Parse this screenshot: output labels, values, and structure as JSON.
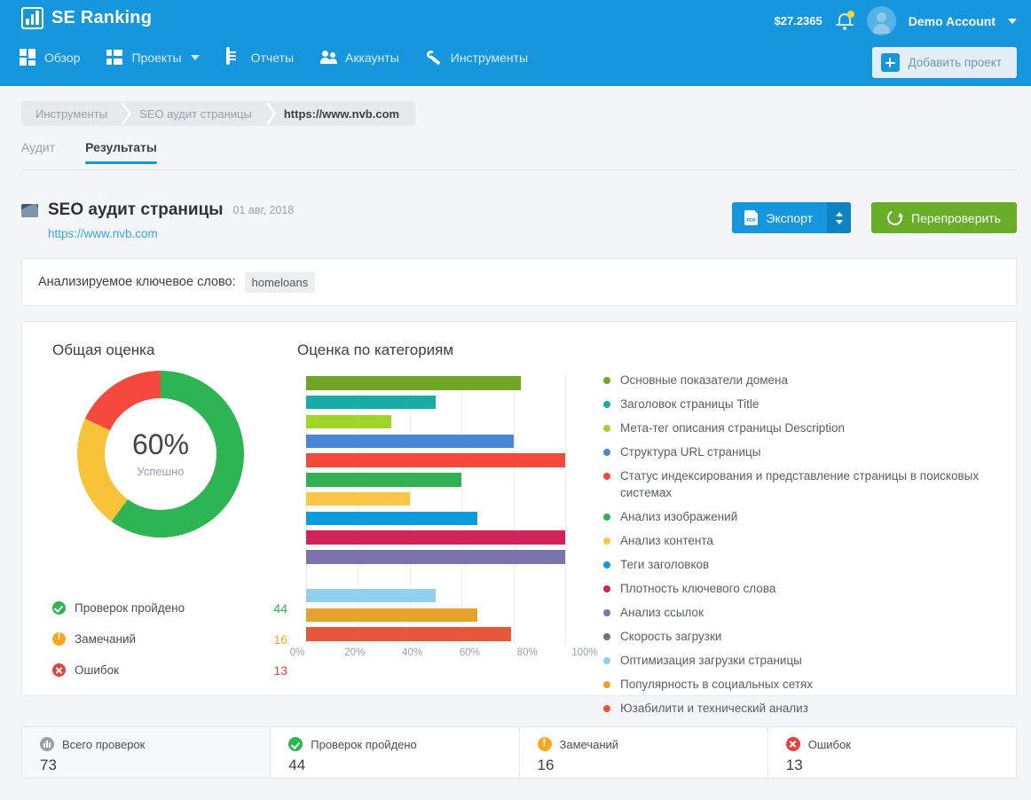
{
  "header": {
    "brand": "SE Ranking",
    "brand_logo_icon": "bar-chart-logo-icon",
    "balance": "$27.2365",
    "bell_icon": "notification-bell-icon",
    "avatar_icon": "user-avatar-icon",
    "account_name": "Demo Account",
    "account_caret_icon": "chevron-down-icon",
    "add_project_label": "Добавить проект",
    "add_project_icon": "plus-icon",
    "nav": [
      {
        "label": "Обзор",
        "icon": "dashboard-grid-icon",
        "caret": false
      },
      {
        "label": "Проекты",
        "icon": "projects-list-icon",
        "caret": true
      },
      {
        "label": "Отчеты",
        "icon": "reports-document-icon",
        "caret": false
      },
      {
        "label": "Аккаунты",
        "icon": "accounts-people-icon",
        "caret": false
      },
      {
        "label": "Инструменты",
        "icon": "tools-wrench-icon",
        "caret": false
      }
    ]
  },
  "breadcrumb": [
    "Инструменты",
    "SEO аудит страницы",
    "https://www.nvb.com"
  ],
  "tabs": [
    {
      "label": "Аудит",
      "active": false
    },
    {
      "label": "Результаты",
      "active": true
    }
  ],
  "page": {
    "icon": "page-audit-icon",
    "title": "SEO аудит страницы",
    "date": "01 авг, 2018",
    "url": "https://www.nvb.com",
    "export_label": "Экспорт",
    "export_icon": "pdf-icon",
    "export_split_icon": "updown-arrows-icon",
    "recheck_label": "Перепроверить",
    "recheck_icon": "reload-icon"
  },
  "keyword_panel": {
    "label": "Анализируемое ключевое слово:",
    "value": "homeloans"
  },
  "overall": {
    "title": "Общая оценка",
    "percent": "60%",
    "subtitle": "Успешно",
    "stats": [
      {
        "label": "Проверок пройдено",
        "value": "44",
        "kind": "ok"
      },
      {
        "label": "Замечаний",
        "value": "16",
        "kind": "warn"
      },
      {
        "label": "Ошибок",
        "value": "13",
        "kind": "err"
      }
    ]
  },
  "categories_title": "Оценка по категориям",
  "summary": [
    {
      "label": "Всего проверок",
      "value": "73",
      "kind": "total"
    },
    {
      "label": "Проверок пройдено",
      "value": "44",
      "kind": "ok"
    },
    {
      "label": "Замечаний",
      "value": "16",
      "kind": "warn"
    },
    {
      "label": "Ошибок",
      "value": "13",
      "kind": "err"
    }
  ],
  "chart_data": [
    {
      "type": "pie",
      "title": "Общая оценка",
      "center_label": "60%",
      "center_sublabel": "Успешно",
      "labels": [
        "Проверок пройдено",
        "Замечаний",
        "Ошибок"
      ],
      "values": [
        44,
        16,
        13
      ],
      "percents": [
        60,
        22,
        18
      ],
      "colors": [
        "#2eb553",
        "#f9c339",
        "#f4493c"
      ],
      "donut": true,
      "legend": "bottom"
    },
    {
      "type": "bar",
      "orientation": "horizontal",
      "title": "Оценка по категориям",
      "xlabel": "",
      "ylabel": "",
      "xlim": [
        0,
        100
      ],
      "xticks": [
        "0%",
        "20%",
        "40%",
        "60%",
        "80%",
        "100%"
      ],
      "grid": true,
      "legend": "right",
      "categories": [
        "Основные показатели домена",
        "Заголовок страницы Title",
        "Мета-тег описания страницы Description",
        "Структура URL страницы",
        "Статус индексирования и представление страницы в поисковых системах",
        "Анализ изображений",
        "Анализ контента",
        "Теги заголовков",
        "Плотность ключевого слова",
        "Анализ ссылок",
        "Скорость загрузки",
        "Оптимизация загрузки страницы",
        "Популярность в социальных сетях",
        "Юзабилити и технический анализ"
      ],
      "values": [
        83,
        50,
        33,
        80,
        100,
        60,
        40,
        66,
        100,
        100,
        0,
        50,
        66,
        79
      ],
      "colors": [
        "#6fa724",
        "#17ada6",
        "#9fd62a",
        "#4a86d8",
        "#f4493c",
        "#33b053",
        "#fbc647",
        "#0d9bdb",
        "#d1225a",
        "#7a73ad",
        "#717577",
        "#91cfee",
        "#e6a32b",
        "#e4573b"
      ]
    }
  ],
  "legend_items": [
    {
      "label": "Основные показатели домена",
      "color": "#6fa724"
    },
    {
      "label": "Заголовок страницы Title",
      "color": "#17ada6"
    },
    {
      "label": "Мета-тег описания страницы Description",
      "color": "#9fd62a"
    },
    {
      "label": "Структура URL страницы",
      "color": "#4a86d8"
    },
    {
      "label": "Статус индексирования и представление страницы в поисковых системах",
      "color": "#f4493c"
    },
    {
      "label": "Анализ изображений",
      "color": "#33b053"
    },
    {
      "label": "Анализ контента",
      "color": "#fbc647"
    },
    {
      "label": "Теги заголовков",
      "color": "#0d9bdb"
    },
    {
      "label": "Плотность ключевого слова",
      "color": "#d1225a"
    },
    {
      "label": "Анализ ссылок",
      "color": "#7a73ad"
    },
    {
      "label": "Скорость загрузки",
      "color": "#717577"
    },
    {
      "label": "Оптимизация загрузки страницы",
      "color": "#91cfee"
    },
    {
      "label": "Популярность в социальных сетях",
      "color": "#e6a32b"
    },
    {
      "label": "Юзабилити и технический анализ",
      "color": "#e4573b"
    }
  ],
  "colors": {
    "brand_blue": "#1596dd",
    "green": "#67ad27",
    "ok": "#2eb553",
    "warn": "#f7a823",
    "err": "#e8403a"
  }
}
